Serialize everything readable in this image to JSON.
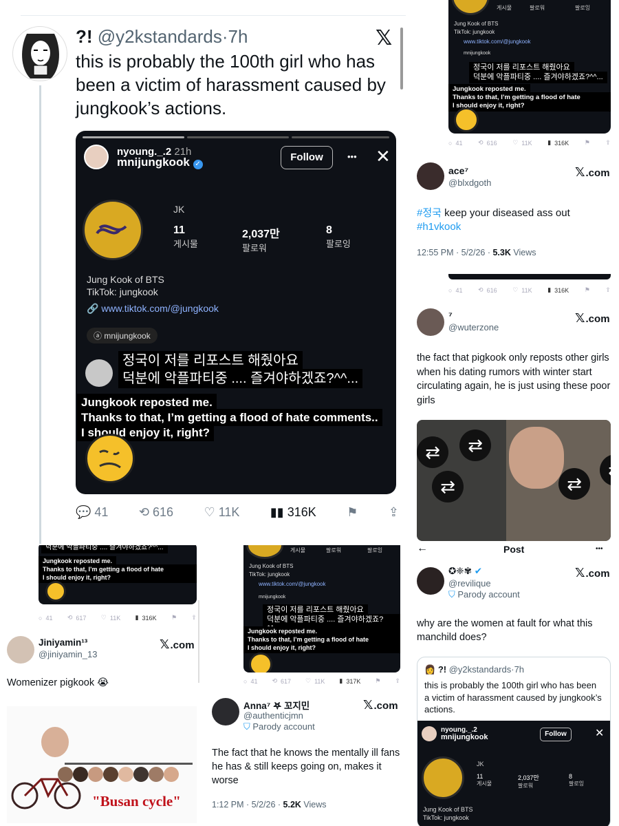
{
  "main_tweet": {
    "name": "?!",
    "handle": "@y2kstandards",
    "dot": "·",
    "time": "7h",
    "text": "this is probably the 100th girl who has been a victim of harassment caused by jungkook’s actions.",
    "counts": {
      "replies": "41",
      "reposts": "616",
      "likes": "11K",
      "views": "316K"
    }
  },
  "story": {
    "user": "nyoung._.2",
    "time": "21h",
    "overlay_user": "mnijungkook",
    "follow_label": "Follow",
    "more": "•••",
    "close": "✕",
    "profile_name": "JK",
    "stats": [
      {
        "value": "11",
        "label": "게시물"
      },
      {
        "value": "2,037만",
        "label": "팔로워"
      },
      {
        "value": "8",
        "label": "팔로잉"
      }
    ],
    "bio_line1": "Jung Kook of BTS",
    "bio_line2": "TikTok: jungkook",
    "link": "www.tiktok.com/@jungkook",
    "threads": "mnijungkook",
    "korean_line1": "정국이 저를 리포스트 해줬아요",
    "korean_line2": "덕분에 악플파티중 .... 즐겨야하겠죠?^^...",
    "sub_line1": "Jungkook reposted me.",
    "sub_line2": "Thanks to that, I’m getting a flood of hate comments..",
    "sub_line3": "I should enjoy it, right?",
    "mini_counts": {
      "replies": "41",
      "reposts": "616",
      "likes": "11K",
      "views": "316K"
    },
    "mini_counts_b": {
      "replies": "41",
      "reposts": "617",
      "likes": "11K",
      "views": "316K"
    },
    "mini_counts_c": {
      "replies": "41",
      "reposts": "617",
      "likes": "11K",
      "views": "317K"
    }
  },
  "x_label": ".com",
  "reply_ace": {
    "name": "ace⁷",
    "handle": "@blxdgoth",
    "hashtag1": "#정국",
    "text": " keep your diseased ass out",
    "hashtag2": "#h1vkook",
    "time": "12:55 PM · 5/2/26 · ",
    "views_num": "5.3K",
    "views_word": " Views"
  },
  "reply_seven": {
    "name": "⁷",
    "handle": "@wuterzone",
    "text": "the fact that pigkook only reposts other girls when his dating rumors with winter start circulating again, he is just using these poor girls"
  },
  "reply_jiniyamin": {
    "name": "Jiniyamin¹³",
    "handle": "@jiniyamin_13",
    "text": "Womenizer pigkook 😭",
    "meme_caption": "\"Busan cycle\""
  },
  "reply_anna": {
    "name": "Anna⁷ 𖤐 꼬지민",
    "handle": "@authenticjmn",
    "badge": "Parody account",
    "text": "The fact that he knows the mentally ill fans he has & still keeps going on, makes it worse",
    "time": "1:12 PM · 5/2/26 · ",
    "views_num": "5.2K",
    "views_word": " Views"
  },
  "reply_revilique": {
    "header": "Post",
    "back": "←",
    "more": "•••",
    "name": "✪❈✾",
    "handle": "@revilique",
    "badge": "Parody account",
    "text": "why are the women at fault for what this manchild does?",
    "quote_name": "?!",
    "quote_handle": "@y2kstandards",
    "quote_time": "·7h",
    "quote_text": "this is probably the 100th girl who has been a victim of harassment caused by jungkook’s actions."
  }
}
